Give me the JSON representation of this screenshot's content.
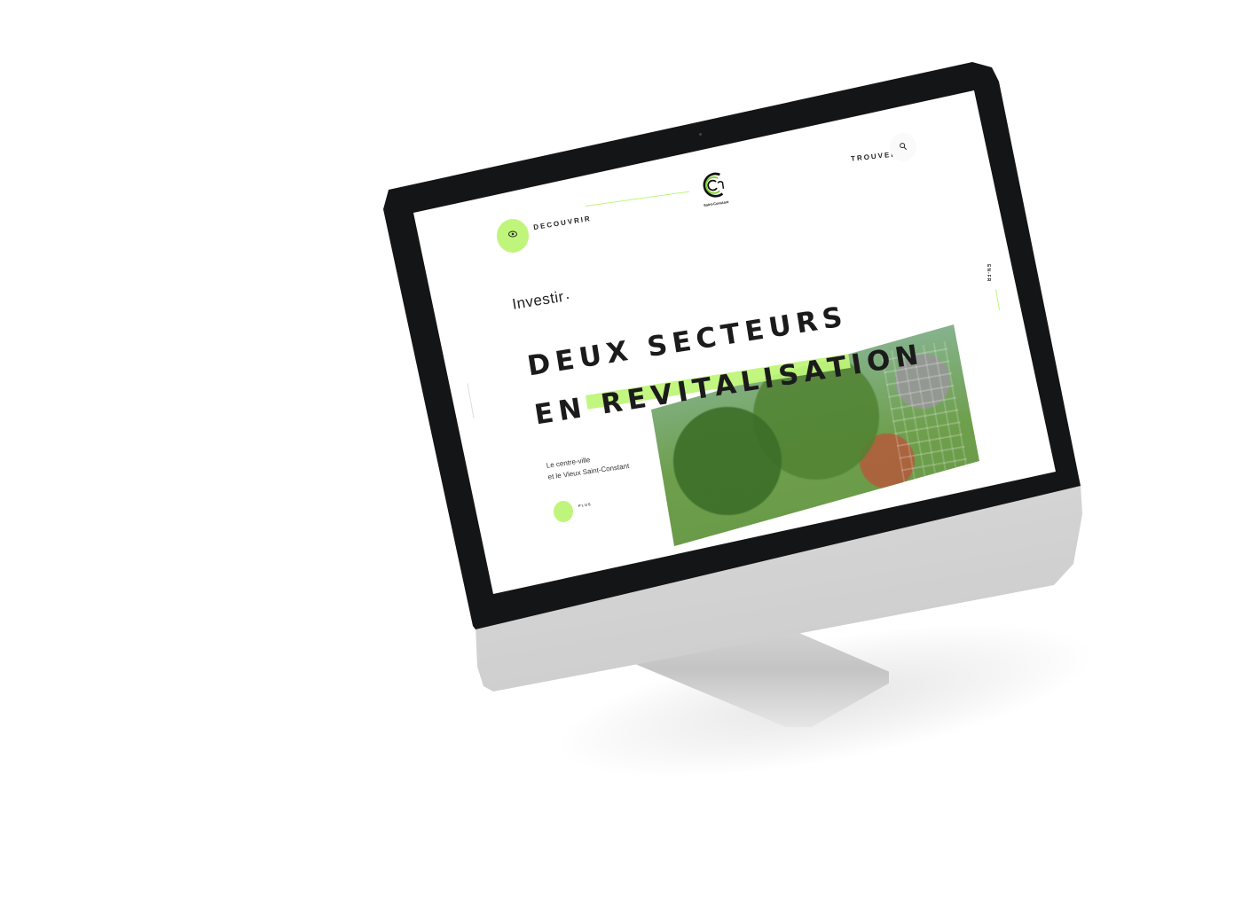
{
  "page": {
    "nav": {
      "discover_label": "DECOUVRIR",
      "find_label": "TROUVER"
    },
    "logo": {
      "text": "Saint-Constant"
    },
    "side_tag": "EN-FR",
    "section_label": "Investir",
    "headline": {
      "line1": "DEUX SECTEURS",
      "line2_prefix": "EN ",
      "line2_highlight": "REVITALISATION"
    },
    "subtitle": {
      "line1": "Le centre-ville",
      "line2": "et le Vieux Saint-Constant"
    },
    "more_label": "PLUS"
  },
  "colors": {
    "accent": "#bff57a",
    "text": "#1b1b1b",
    "bezel": "#141516",
    "background": "#ffffff"
  },
  "icons": {
    "discover": "eye-icon",
    "find": "search-icon"
  }
}
